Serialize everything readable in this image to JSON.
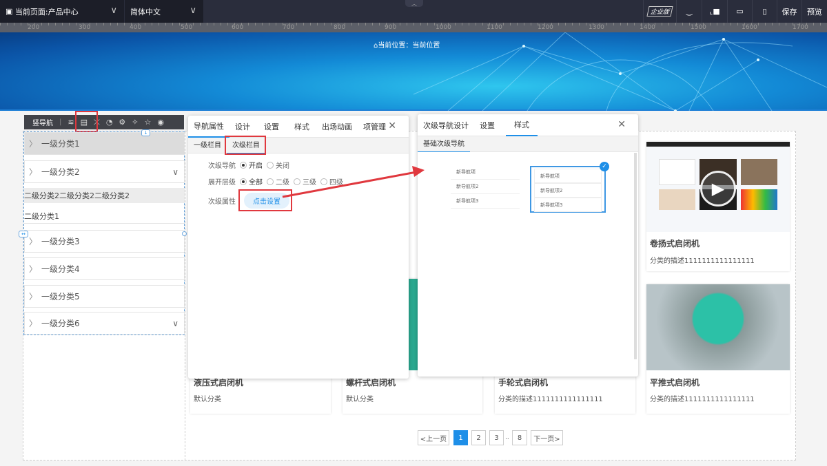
{
  "topbar": {
    "page_select": "当前页面:产品中心",
    "lang_select": "简体中文",
    "edition_badge": "企业版",
    "save": "保存",
    "preview": "预览"
  },
  "ruler": [
    "200",
    "300",
    "400",
    "500",
    "600",
    "700",
    "800",
    "900",
    "1000",
    "1100",
    "1200",
    "1300",
    "1400",
    "1500",
    "1600",
    "1700"
  ],
  "banner": {
    "crumb": "当前位置：当前位置"
  },
  "navtool": {
    "label": "竖导航"
  },
  "nav": {
    "items": [
      "一级分类1",
      "一级分类2",
      "一级分类3",
      "一级分类4",
      "一级分类5",
      "一级分类6"
    ],
    "sub2": "二级分类2二级分类2二级分类2",
    "sub1": "二级分类1"
  },
  "panel1": {
    "tabs": [
      "导航属性",
      "设计",
      "设置",
      "样式",
      "出场动画",
      "项管理"
    ],
    "subtabs": [
      "一级栏目",
      "次级栏目"
    ],
    "sec_nav_label": "次级导航",
    "sec_nav_options": [
      "开启",
      "关闭"
    ],
    "expand_label": "展开层级",
    "expand_options": [
      "全部",
      "二级",
      "三级",
      "四级"
    ],
    "sec_attr_label": "次级属性",
    "set_button": "点击设置"
  },
  "panel2": {
    "tabs": [
      "次级导航设计",
      "设置",
      "样式"
    ],
    "subtab": "基础次级导航",
    "sample_items": [
      "新导航项",
      "新导航项2",
      "新导航项3"
    ]
  },
  "products": [
    {
      "title": "卷扬式启闭机",
      "desc": "分类的描述1111111111111111"
    },
    {
      "title": "液压式启闭机",
      "desc": "默认分类"
    },
    {
      "title": "螺杆式启闭机",
      "desc": "默认分类"
    },
    {
      "title": "手轮式启闭机",
      "desc": "分类的描述1111111111111111"
    },
    {
      "title": "平推式启闭机",
      "desc": "分类的描述1111111111111111"
    }
  ],
  "pagination": {
    "prev": "<上一页",
    "pages": [
      "1",
      "2",
      "3"
    ],
    "ellipsis": "..",
    "last": "8",
    "next": "下一页>",
    "current": "1"
  },
  "colors": {
    "accent": "#1e8fe8",
    "highlight": "#e0383e"
  }
}
